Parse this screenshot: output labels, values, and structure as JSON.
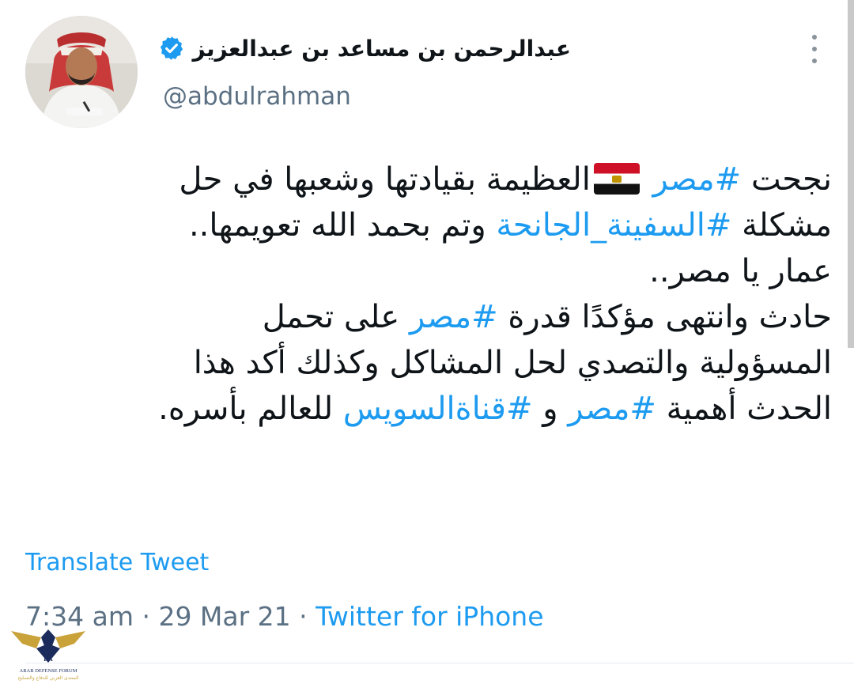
{
  "author": {
    "display_name": "عبدالرحمن بن مساعد بن عبدالعزيز",
    "handle": "@abdulrahman",
    "verified_icon": "verified-badge-icon",
    "verified_color": "#1d9bf0"
  },
  "tweet": {
    "l1_a": "نجحت ",
    "l1_tag": "#مصر",
    "l1_b": "العظيمة بقيادتها وشعبها في حل",
    "l2_a": "مشكلة ",
    "l2_tag": "#السفينة_الجانحة",
    "l2_b": " وتم بحمد الله تعويمها..",
    "l3": "عمار يا مصر..",
    "l4_a": "حادث وانتهى مؤكدًا قدرة ",
    "l4_tag": "#مصر",
    "l4_b": " على تحمل",
    "l5": "المسؤولية والتصدي لحل المشاكل وكذلك أكد هذا",
    "l6_a": "الحدث أهمية ",
    "l6_tag1": "#مصر",
    "l6_b": " و ",
    "l6_tag2": "#قناةالسويس",
    "l6_c": " للعالم بأسره."
  },
  "translate_label": "Translate Tweet",
  "meta": {
    "time": "7:34 am",
    "sep1": " · ",
    "date": "29 Mar 21",
    "sep2": " · ",
    "source": "Twitter for iPhone"
  },
  "watermark": {
    "text_en": "ARAB DEFENSE FORUM",
    "text_ar": "المنتدى العربي للدفاع والتسليح"
  },
  "colors": {
    "link": "#1d9bf0",
    "secondary": "#5b7083",
    "text": "#0f1419"
  }
}
